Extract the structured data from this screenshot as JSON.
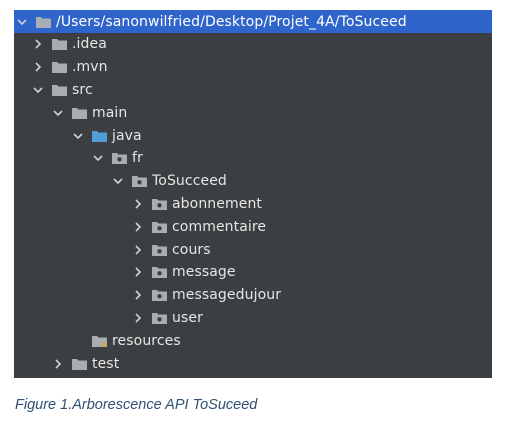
{
  "tree": [
    {
      "label": "/Users/sanonwilfried/Desktop/Projet_4A/ToSuceed",
      "depth": 0,
      "chevron": "down",
      "icon": "folder-icon",
      "selected": true
    },
    {
      "label": ".idea",
      "depth": 1,
      "chevron": "right",
      "icon": "folder-icon"
    },
    {
      "label": ".mvn",
      "depth": 1,
      "chevron": "right",
      "icon": "folder-icon"
    },
    {
      "label": "src",
      "depth": 1,
      "chevron": "down",
      "icon": "folder-icon"
    },
    {
      "label": "main",
      "depth": 2,
      "chevron": "down",
      "icon": "folder-icon"
    },
    {
      "label": "java",
      "depth": 3,
      "chevron": "down",
      "icon": "source-folder-icon"
    },
    {
      "label": "fr",
      "depth": 4,
      "chevron": "down",
      "icon": "package-icon"
    },
    {
      "label": "ToSucceed",
      "depth": 5,
      "chevron": "down",
      "icon": "package-icon"
    },
    {
      "label": "abonnement",
      "depth": 6,
      "chevron": "right",
      "icon": "package-icon"
    },
    {
      "label": "commentaire",
      "depth": 6,
      "chevron": "right",
      "icon": "package-icon"
    },
    {
      "label": "cours",
      "depth": 6,
      "chevron": "right",
      "icon": "package-icon"
    },
    {
      "label": "message",
      "depth": 6,
      "chevron": "right",
      "icon": "package-icon"
    },
    {
      "label": "messagedujour",
      "depth": 6,
      "chevron": "right",
      "icon": "package-icon"
    },
    {
      "label": "user",
      "depth": 6,
      "chevron": "right",
      "icon": "package-icon"
    },
    {
      "label": "resources",
      "depth": 3,
      "chevron": "none",
      "icon": "resources-folder-icon"
    },
    {
      "label": "test",
      "depth": 2,
      "chevron": "right",
      "icon": "folder-icon"
    }
  ],
  "caption": "Figure 1.Arborescence API ToSuceed",
  "colors": {
    "background": "#3c3f41",
    "selection": "#2f65ca",
    "folder": "#a8adb3",
    "source_folder": "#4f9fd6",
    "text": "#e6e6e6",
    "caption": "#2f4f72"
  }
}
